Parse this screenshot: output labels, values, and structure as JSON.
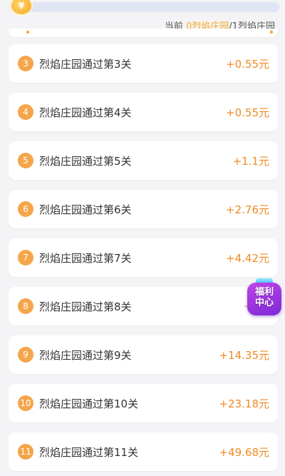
{
  "progress": {
    "coin_symbol": "¥",
    "fraction": 0,
    "status_prefix": "当前 ",
    "status_highlight": "0烈焰庄园",
    "status_suffix": "/1烈焰庄园"
  },
  "tasks": [
    {
      "num": "3",
      "label": "烈焰庄园通过第3关",
      "reward": "+0.55元"
    },
    {
      "num": "4",
      "label": "烈焰庄园通过第4关",
      "reward": "+0.55元"
    },
    {
      "num": "5",
      "label": "烈焰庄园通过第5关",
      "reward": "+1.1元"
    },
    {
      "num": "6",
      "label": "烈焰庄园通过第6关",
      "reward": "+2.76元"
    },
    {
      "num": "7",
      "label": "烈焰庄园通过第7关",
      "reward": "+4.42元"
    },
    {
      "num": "8",
      "label": "烈焰庄园通过第8关",
      "reward": "+6.6"
    },
    {
      "num": "9",
      "label": "烈焰庄园通过第9关",
      "reward": "+14.35元"
    },
    {
      "num": "10",
      "label": "烈焰庄园通过第10关",
      "reward": "+23.18元"
    },
    {
      "num": "11",
      "label": "烈焰庄园通过第11关",
      "reward": "+49.68元"
    }
  ],
  "welfare": {
    "line1": "福利",
    "line2": "中心",
    "icon": "gift-icon"
  },
  "colors": {
    "accent": "#f5a623",
    "reward": "#f08a24",
    "badge": "#f5a54a",
    "welfare": "#a83ae0"
  }
}
